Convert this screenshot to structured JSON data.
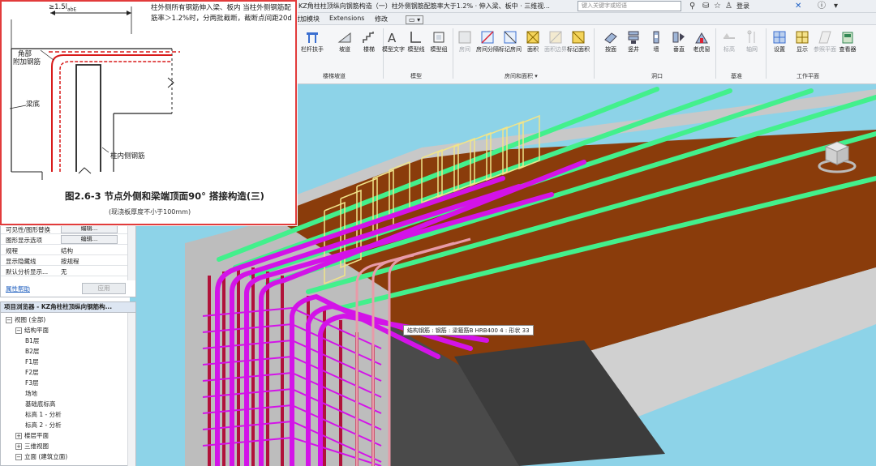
{
  "titlebar": {
    "title": "KZ角柱柱顶纵向钢筋构造（一）柱外侧钢筋配筋率大于1.2% · 伸入梁、板中 · 三维视...",
    "search_placeholder": "键入关键字或短语",
    "login": "登录"
  },
  "tabs": [
    "附加模块",
    "Extensions",
    "修改"
  ],
  "ribbon": {
    "buttons": [
      {
        "label": "栏杆扶手"
      },
      {
        "label": "坡道"
      },
      {
        "label": "楼梯"
      },
      {
        "label": "模型文字"
      },
      {
        "label": "模型线"
      },
      {
        "label": "模型组"
      },
      {
        "label": "房间"
      },
      {
        "label": "房间分隔"
      },
      {
        "label": "标记房间"
      },
      {
        "label": "面积"
      },
      {
        "label": "面积边界"
      },
      {
        "label": "标记面积"
      },
      {
        "label": "按面"
      },
      {
        "label": "竖井"
      },
      {
        "label": "墙"
      },
      {
        "label": "垂直"
      },
      {
        "label": "老虎窗"
      },
      {
        "label": "标高"
      },
      {
        "label": "轴网"
      },
      {
        "label": "设置"
      },
      {
        "label": "显示"
      },
      {
        "label": "参照平面"
      },
      {
        "label": "查看器"
      }
    ],
    "groups": [
      "楼梯坡道",
      "模型",
      "房间和面积 ▾",
      "洞口",
      "基准",
      "工作平面"
    ]
  },
  "properties": {
    "rows": [
      {
        "key": "可见性/图形替换",
        "value": "编辑..."
      },
      {
        "key": "图形显示选项",
        "value": "编辑..."
      },
      {
        "key": "规程",
        "value": "结构"
      },
      {
        "key": "显示隐藏线",
        "value": "按规程"
      },
      {
        "key": "默认分析显示...",
        "value": "无"
      }
    ],
    "help": "属性帮助",
    "apply": "应用"
  },
  "browser": {
    "header": "项目浏览器 - KZ角柱柱顶纵向钢筋构...",
    "items": [
      {
        "label": "视图 (全部)",
        "level": 0,
        "toggle": "−"
      },
      {
        "label": "结构平面",
        "level": 1,
        "toggle": "−"
      },
      {
        "label": "B1层",
        "level": 2
      },
      {
        "label": "B2层",
        "level": 2
      },
      {
        "label": "F1层",
        "level": 2
      },
      {
        "label": "F2层",
        "level": 2
      },
      {
        "label": "F3层",
        "level": 2
      },
      {
        "label": "场地",
        "level": 2
      },
      {
        "label": "基础底标高",
        "level": 2
      },
      {
        "label": "标高 1 - 分析",
        "level": 2
      },
      {
        "label": "标高 2 - 分析",
        "level": 2
      },
      {
        "label": "楼层平面",
        "level": 1,
        "toggle": "+"
      },
      {
        "label": "三维视图",
        "level": 1,
        "toggle": "+"
      },
      {
        "label": "立面 (建筑立面)",
        "level": 1,
        "toggle": "−"
      }
    ]
  },
  "tooltip": "结构钢筋 : 钢筋 : 梁箍筋B HRB400 4 : 形状 33",
  "diagram": {
    "dimension": "≥1.5l",
    "dimension_sub": "abE",
    "note": "柱外侧所有钢筋伸入梁、板内 当柱外侧钢筋配筋率＞1.2%时，分两批截断，截断点间距20d",
    "labels": {
      "corner": "角部",
      "extra": "附加钢筋",
      "beam_top": "梁底",
      "inner_bar": "柱内侧钢筋"
    },
    "caption": "图2.6-3  节点外侧和梁端顶面90° 搭接构造(三)",
    "subcaption": "(现浇板厚度不小于100mm)"
  },
  "colors": {
    "slab": "#8a3c0b",
    "wall": "#bfbfbf",
    "sky": "#8dd3e8",
    "green_bar": "#43f08c",
    "magenta_bar": "#d313e8",
    "red_bar": "#b0123a",
    "yellow_stirrup": "#f0e48a"
  }
}
